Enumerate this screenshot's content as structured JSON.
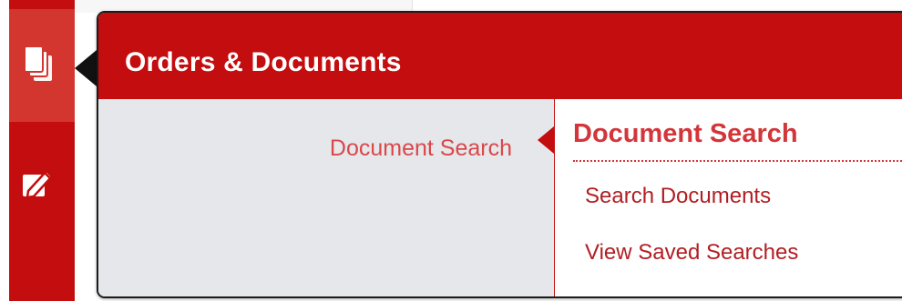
{
  "sidebar": {
    "items": [
      {
        "icon": "documents-icon",
        "active": true
      },
      {
        "icon": "edit-document-icon",
        "active": false
      }
    ]
  },
  "flyout": {
    "title": "Orders & Documents",
    "category": "Document Search",
    "section": {
      "heading": "Document Search",
      "links": [
        "Search Documents",
        "View Saved Searches"
      ]
    }
  },
  "colors": {
    "brand_red": "#c30d0f",
    "active_nav": "#d3362f",
    "category_bg": "#e5e7ea",
    "link_red": "#b11e22"
  }
}
